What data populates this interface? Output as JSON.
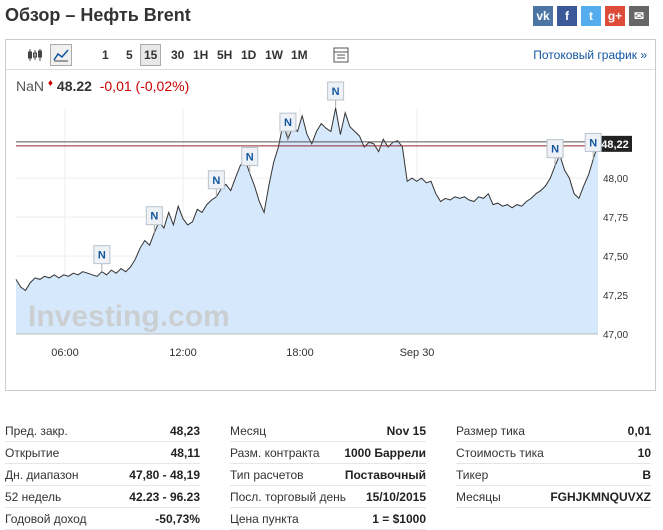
{
  "title": "Обзор – Нефть Brent",
  "social": [
    {
      "icon": "vk-icon",
      "glyph": "vk"
    },
    {
      "icon": "facebook-icon",
      "glyph": "f"
    },
    {
      "icon": "twitter-icon",
      "glyph": "t"
    },
    {
      "icon": "google-plus-icon",
      "glyph": "g+"
    },
    {
      "icon": "email-icon",
      "glyph": "✉"
    }
  ],
  "toolbar": {
    "timeframes": [
      "1",
      "5",
      "15",
      "30",
      "1H",
      "5H",
      "1D",
      "1W",
      "1M"
    ],
    "active_timeframe": "15",
    "stream_link": "Потоковый график »"
  },
  "quote": {
    "symbol": "NaN",
    "price": "48.22",
    "change": "-0,01",
    "change_pct": "(-0,02%)"
  },
  "colors": {
    "area_fill": "#d6e8fb",
    "line": "#333333",
    "price_line": "#555555",
    "negative": "#cc0000",
    "link": "#1256a0"
  },
  "chart_data": {
    "type": "area",
    "watermark": "Investing.com",
    "x_tick_labels": [
      "06:00",
      "12:00",
      "18:00",
      "Sep 30"
    ],
    "y_tick_labels": [
      "47,00",
      "47,25",
      "47,50",
      "47,75",
      "48,00"
    ],
    "ylim": [
      47.0,
      48.45
    ],
    "last_price_label": "48,22",
    "last_price": 48.22,
    "grid": true,
    "news_marker": "N",
    "series": [
      {
        "values": [
          47.35,
          47.3,
          47.28,
          47.33,
          47.36,
          47.35,
          47.37,
          47.36,
          47.38,
          47.36,
          47.38,
          47.37,
          47.39,
          47.38,
          47.4,
          47.39,
          47.38,
          47.37,
          47.4,
          47.38,
          47.41,
          47.39,
          47.42,
          47.4,
          47.43,
          47.48,
          47.55,
          47.6,
          47.57,
          47.65,
          47.72,
          47.68,
          47.78,
          47.7,
          47.82,
          47.74,
          47.7,
          47.72,
          47.8,
          47.78,
          47.83,
          47.86,
          47.88,
          47.93,
          47.96,
          47.92,
          48.0,
          48.08,
          48.12,
          48.03,
          47.95,
          47.85,
          47.78,
          47.95,
          48.1,
          48.2,
          48.35,
          48.25,
          48.33,
          48.3,
          48.4,
          48.28,
          48.22,
          48.3,
          48.35,
          48.32,
          48.3,
          48.45,
          48.28,
          48.42,
          48.33,
          48.3,
          48.27,
          48.2,
          48.23,
          48.22,
          48.17,
          48.25,
          48.2,
          48.23,
          48.24,
          48.2,
          47.98,
          48.0,
          47.98,
          48.0,
          47.97,
          47.98,
          47.9,
          47.85,
          47.87,
          47.86,
          47.88,
          47.87,
          47.88,
          47.86,
          47.85,
          47.88,
          47.87,
          47.9,
          47.83,
          47.84,
          47.82,
          47.83,
          47.81,
          47.83,
          47.82,
          47.85,
          47.87,
          47.9,
          47.92,
          47.95,
          48.0,
          48.08,
          48.15,
          48.05,
          48.0,
          47.9,
          47.87,
          47.95,
          48.02,
          48.12,
          48.22
        ]
      }
    ],
    "news_marker_indices": [
      18,
      29,
      42,
      49,
      57,
      67,
      113,
      121
    ]
  },
  "stats": {
    "col1": [
      {
        "label": "Пред. закр.",
        "value": "48,23"
      },
      {
        "label": "Открытие",
        "value": "48,11"
      },
      {
        "label": "Дн. диапазон",
        "value": "47,80 - 48,19"
      },
      {
        "label": "52 недель",
        "value": "42.23 - 96.23"
      },
      {
        "label": "Годовой доход",
        "value": "-50,73%"
      }
    ],
    "col2": [
      {
        "label": "Месяц",
        "value": "Nov 15"
      },
      {
        "label": "Разм. контракта",
        "value": "1000 Баррели"
      },
      {
        "label": "Тип расчетов",
        "value": "Поставочный"
      },
      {
        "label": "Посл. торговый день",
        "value": "15/10/2015"
      },
      {
        "label": "Цена пункта",
        "value": "1 = $1000"
      }
    ],
    "col3": [
      {
        "label": "Размер тика",
        "value": "0,01"
      },
      {
        "label": "Стоимость тика",
        "value": "10"
      },
      {
        "label": "Тикер",
        "value": "B"
      },
      {
        "label": "Месяцы",
        "value": "FGHJKMNQUVXZ"
      }
    ]
  }
}
